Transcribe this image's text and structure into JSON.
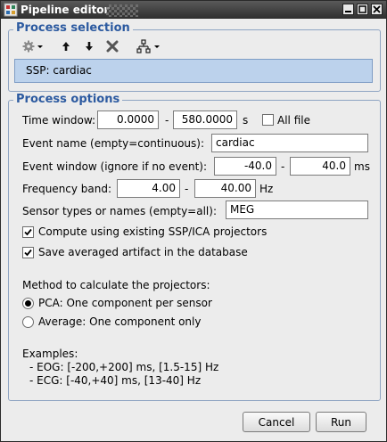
{
  "window": {
    "title": "Pipeline editor"
  },
  "process_selection": {
    "legend": "Process selection",
    "toolbar_icons": [
      "gear-menu-icon",
      "move-up-arrow-icon",
      "move-down-arrow-icon",
      "delete-x-icon",
      "pipeline-tree-menu-icon"
    ],
    "items": [
      {
        "label": "SSP: cardiac",
        "selected": true
      }
    ]
  },
  "process_options": {
    "legend": "Process options",
    "time_window": {
      "label": "Time window:",
      "start": "0.0000",
      "sep": "-",
      "end": "580.0000",
      "unit": "s"
    },
    "all_file": {
      "label": "All file",
      "checked": false
    },
    "event_name": {
      "label": "Event name (empty=continuous):",
      "value": "cardiac"
    },
    "event_window": {
      "label": "Event window (ignore if no event):",
      "start": "-40.0",
      "sep": "-",
      "end": "40.0",
      "unit": "ms"
    },
    "frequency_band": {
      "label": "Frequency band:",
      "low": "4.00",
      "sep": "-",
      "high": "40.00",
      "unit": "Hz"
    },
    "sensor_types": {
      "label": "Sensor types or names (empty=all):",
      "value": "MEG"
    },
    "use_existing_ssp": {
      "label": "Compute using existing SSP/ICA projectors",
      "checked": true
    },
    "save_artifact": {
      "label": "Save averaged artifact in the database",
      "checked": true
    },
    "method": {
      "label": "Method to calculate the projectors:",
      "options": [
        {
          "label": "PCA: One component per sensor",
          "selected": true
        },
        {
          "label": "Average: One component only",
          "selected": false
        }
      ]
    },
    "examples": {
      "heading": "Examples:",
      "lines": [
        "- EOG: [-200,+200] ms, [1.5-15] Hz",
        "- ECG: [-40,+40] ms, [13-40] Hz"
      ]
    }
  },
  "buttons": {
    "cancel": "Cancel",
    "run": "Run"
  },
  "colors": {
    "accent": "#2c5aa0",
    "selection": "#bcd2ec",
    "title_bar": "#3a3a3a"
  }
}
